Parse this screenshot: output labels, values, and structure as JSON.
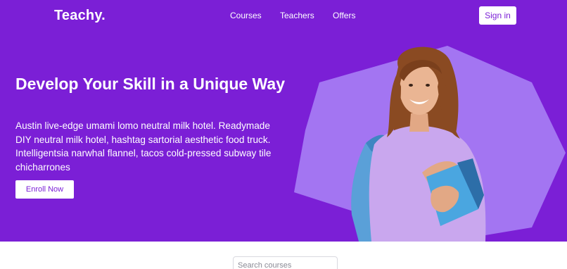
{
  "brand": {
    "name": "Teachy."
  },
  "nav": {
    "items": [
      {
        "label": "Courses"
      },
      {
        "label": "Teachers"
      },
      {
        "label": "Offers"
      }
    ]
  },
  "header": {
    "signin_label": "Sign in"
  },
  "hero": {
    "headline": "Develop Your Skill in a Unique Way",
    "description": "Austin live-edge umami lomo neutral milk hotel. Readymade DIY neutral milk hotel, hashtag sartorial aesthetic food truck. Intelligentsia narwhal flannel, tacos cold-pressed subway tile chicharrones",
    "cta_label": "Enroll Now",
    "image": "student-with-books-photo"
  },
  "search": {
    "placeholder": "Search courses",
    "value": ""
  },
  "colors": {
    "brand_purple": "#7b1fd6",
    "hexagon_lilac": "#a375f2",
    "white": "#ffffff"
  }
}
